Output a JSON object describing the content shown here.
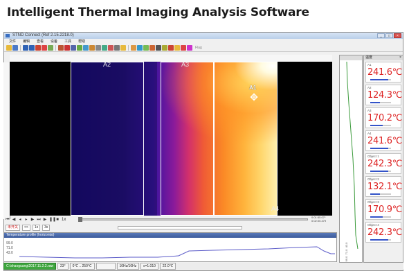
{
  "heading": "Intelligent Thermal Imaging Analysis Software",
  "window": {
    "title": "STND Connect (Ref 2.15.2218.0)",
    "controls": [
      "_",
      "□",
      "×"
    ]
  },
  "menu": [
    "文件",
    "编辑",
    "查看",
    "设备",
    "工具",
    "帮助"
  ],
  "toolbar": {
    "flag_label": "Flag"
  },
  "image": {
    "regions": [
      {
        "label": "A2"
      },
      {
        "label": "A3"
      },
      {
        "label": "A4"
      }
    ],
    "point_label": "A1"
  },
  "playback": {
    "time_current": "0:01:55.07*",
    "time_total": "0:02:00.479",
    "speed_label": "1x",
    "mode1": "未开关",
    "mode2": "3x"
  },
  "profile": {
    "title": "Temperature profile (horizontal)",
    "ticks": [
      "99.0",
      "71.0",
      "43.0"
    ]
  },
  "side_graph": {
    "ticks": [
      "99.0",
      "71.0",
      "43.0"
    ]
  },
  "measure_panel": {
    "title": "温度",
    "items": [
      {
        "label": "A1",
        "value": "241.6℃",
        "level": 0.85
      },
      {
        "label": "A2",
        "value": "124.3℃",
        "level": 0.45
      },
      {
        "label": "A3",
        "value": "170.2℃",
        "level": 0.6
      },
      {
        "label": "A4",
        "value": "241.6℃",
        "level": 0.85
      },
      {
        "label": "Object 1",
        "value": "242.3℃",
        "level": 0.85
      },
      {
        "label": "Object 2",
        "value": "132.1℃",
        "level": 0.48
      },
      {
        "label": "Object 3",
        "value": "170.9℃",
        "level": 0.6
      },
      {
        "label": "Object 4",
        "value": "242.3℃",
        "level": 0.85
      }
    ]
  },
  "status": {
    "file": "C:\\shaoguang\\2017.11.2.2.raw",
    "emissivity_angle": "23°",
    "range": "0℃ .. 250℃",
    "rate": "10Hz/10Hz",
    "epsilon": "ε=1.010",
    "ambient": "22.0℃"
  },
  "colors": {
    "accent": "#d22222",
    "title_bar": "#3d5c9c",
    "status_green": "#3ea63e"
  }
}
